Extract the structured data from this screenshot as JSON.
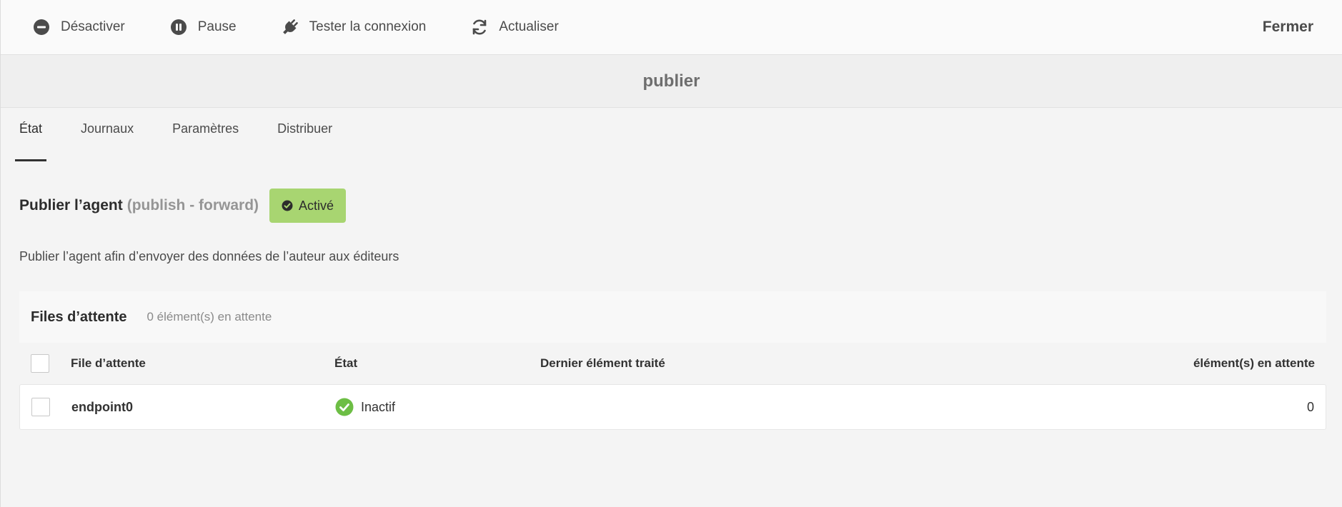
{
  "actionbar": {
    "deactivate": "Désactiver",
    "pause": "Pause",
    "test_connection": "Tester la connexion",
    "refresh": "Actualiser",
    "close": "Fermer"
  },
  "title": "publier",
  "tabs": [
    {
      "label": "État",
      "active": true
    },
    {
      "label": "Journaux",
      "active": false
    },
    {
      "label": "Paramètres",
      "active": false
    },
    {
      "label": "Distribuer",
      "active": false
    }
  ],
  "agent": {
    "title": "Publier l’agent",
    "subtitle": "(publish - forward)",
    "status": "Activé",
    "description": "Publier l’agent afin d’envoyer des données de l’auteur aux éditeurs"
  },
  "queues": {
    "title": "Files d’attente",
    "count_text": "0 élément(s) en attente",
    "columns": {
      "name": "File d’attente",
      "state": "État",
      "last": "Dernier élément traité",
      "pending": "élément(s) en attente"
    },
    "rows": [
      {
        "name": "endpoint0",
        "state": "Inactif",
        "last": "",
        "pending": "0"
      }
    ]
  },
  "colors": {
    "status_green": "#a8d571",
    "check_green": "#6dbe45"
  }
}
